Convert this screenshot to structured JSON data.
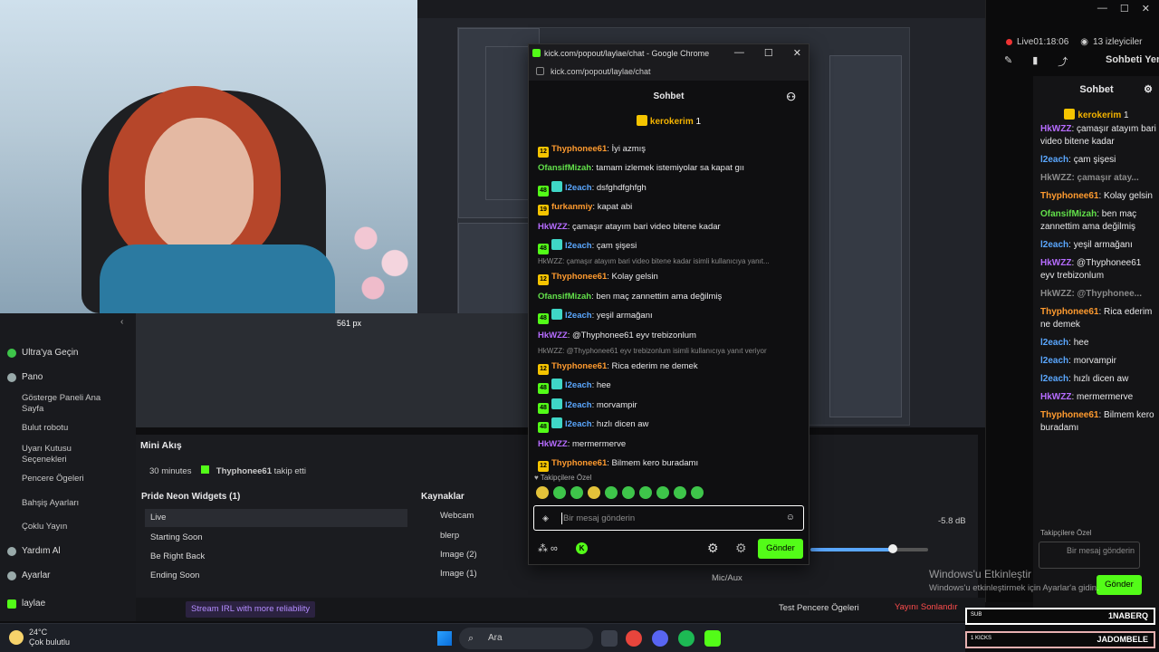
{
  "popup": {
    "window_title": "kick.com/popout/laylae/chat - Google Chrome",
    "url": "kick.com/popout/laylae/chat",
    "chat_title": "Sohbet",
    "pinned_user": "kerokerim",
    "pinned_count": "1",
    "messages": [
      {
        "type": "msg",
        "badges": [
          "12"
        ],
        "user": "Thyphonee61",
        "color": "orange",
        "text": "İyi azmış"
      },
      {
        "type": "msg",
        "badges": [],
        "user": "OfansifMizah",
        "color": "green",
        "text": "tamam izlemek istemiyolar sa kapat gıı"
      },
      {
        "type": "msg",
        "badges": [
          "48",
          "sub"
        ],
        "user": "l2each",
        "color": "blue",
        "text": "dsfghdfghfgh"
      },
      {
        "type": "msg",
        "badges": [
          "19"
        ],
        "user": "furkanmiy",
        "color": "orange",
        "text": "kapat abi"
      },
      {
        "type": "msg",
        "badges": [],
        "user": "HkWZZ",
        "color": "purple",
        "text": "çamaşır atayım bari video bitene kadar"
      },
      {
        "type": "msg",
        "badges": [
          "48",
          "sub"
        ],
        "user": "l2each",
        "color": "blue",
        "text": "çam şişesi"
      },
      {
        "type": "reply",
        "text": "HkWZZ: çamaşır atayım bari video bitene kadar isimli kullanıcıya yanıt..."
      },
      {
        "type": "msg",
        "badges": [
          "12"
        ],
        "user": "Thyphonee61",
        "color": "orange",
        "text": "Kolay gelsin"
      },
      {
        "type": "msg",
        "badges": [],
        "user": "OfansifMizah",
        "color": "green",
        "text": "ben maç zannettim ama değilmiş"
      },
      {
        "type": "msg",
        "badges": [
          "48",
          "sub"
        ],
        "user": "l2each",
        "color": "blue",
        "text": "yeşil armağanı"
      },
      {
        "type": "msg",
        "badges": [],
        "user": "HkWZZ",
        "color": "purple",
        "text": "@Thyphonee61 eyv trebizonlum"
      },
      {
        "type": "reply",
        "text": "HkWZZ: @Thyphonee61 eyv trebizonlum isimli kullanıcıya yanıt veriyor"
      },
      {
        "type": "msg",
        "badges": [
          "12"
        ],
        "user": "Thyphonee61",
        "color": "orange",
        "text": "Rica ederim ne demek"
      },
      {
        "type": "msg",
        "badges": [
          "48",
          "sub"
        ],
        "user": "l2each",
        "color": "blue",
        "text": "hee"
      },
      {
        "type": "msg",
        "badges": [
          "48",
          "sub"
        ],
        "user": "l2each",
        "color": "blue",
        "text": "morvampir"
      },
      {
        "type": "msg",
        "badges": [
          "48",
          "sub"
        ],
        "user": "l2each",
        "color": "blue",
        "text": "hızlı dicen aw"
      },
      {
        "type": "msg",
        "badges": [],
        "user": "HkWZZ",
        "color": "purple",
        "text": "mermermerve"
      },
      {
        "type": "msg",
        "badges": [
          "12"
        ],
        "user": "Thyphonee61",
        "color": "orange",
        "text": "Bilmem kero buradamı"
      }
    ],
    "follower_note": "Takipçilere Özel",
    "input_placeholder": "Bir mesaj gönderin",
    "send_label": "Gönder"
  },
  "right_panel": {
    "live_time": "Live01:18:06",
    "viewers": "13 izleyiciler",
    "refresh_chat": "Sohbeti Yenile",
    "chat_title": "Sohbet",
    "pinned_user": "kerokerim",
    "pinned_count": "1",
    "messages": [
      {
        "user": "HkWZZ",
        "color": "purple",
        "text": "çamaşır atayım bari video bitene kadar"
      },
      {
        "user": "l2each",
        "color": "blue",
        "text": "çam şişesi"
      },
      {
        "user": "HkWZZ: çamaşır atay...",
        "color": "gray",
        "text": ""
      },
      {
        "user": "Thyphonee61",
        "color": "orange",
        "text": "Kolay gelsin"
      },
      {
        "user": "OfansifMizah",
        "color": "green",
        "text": "ben maç zannettim ama değilmiş"
      },
      {
        "user": "l2each",
        "color": "blue",
        "text": "yeşil armağanı"
      },
      {
        "user": "HkWZZ",
        "color": "purple",
        "text": "@Thyphonee61 eyv trebizonlum"
      },
      {
        "user": "HkWZZ: @Thyphonee...",
        "color": "gray",
        "text": ""
      },
      {
        "user": "Thyphonee61",
        "color": "orange",
        "text": "Rica ederim ne demek"
      },
      {
        "user": "l2each",
        "color": "blue",
        "text": "hee"
      },
      {
        "user": "l2each",
        "color": "blue",
        "text": "morvampir"
      },
      {
        "user": "l2each",
        "color": "blue",
        "text": "hızlı dicen aw"
      },
      {
        "user": "HkWZZ",
        "color": "purple",
        "text": "mermermerve"
      },
      {
        "user": "Thyphonee61",
        "color": "orange",
        "text": "Bilmem kero buradamı"
      }
    ],
    "follower_note": "Takipçilere Özel",
    "input_placeholder": "Bir mesaj gönderin",
    "send_label": "Gönder"
  },
  "sidebar": {
    "items": [
      {
        "label": "Ultra'ya Geçin"
      },
      {
        "label": "Pano"
      }
    ],
    "sub_items": [
      "Gösterge Paneli Ana Sayfa",
      "Bulut robotu",
      "Uyarı Kutusu Seçenekleri",
      "Pencere Ögeleri",
      "Bahşiş Ayarları",
      "Çoklu Yayın"
    ],
    "bottom_items": [
      {
        "label": "Yardım Al"
      },
      {
        "label": "Ayarlar"
      },
      {
        "label": "laylae"
      }
    ]
  },
  "mini_akis": {
    "title": "Mini Akış",
    "time": "30 minutes",
    "follower": "Thyphonee61",
    "action": "takip etti"
  },
  "scenes": {
    "header": "Pride Neon Widgets (1)",
    "items": [
      "Live",
      "Starting Soon",
      "Be Right Back",
      "Ending Soon"
    ]
  },
  "sources": {
    "header": "Kaynaklar",
    "items": [
      "Webcam",
      "blerp",
      "Image (2)",
      "Image (1)"
    ]
  },
  "audio": {
    "mic_label": "Mic/Aux",
    "db": "-5.8 dB"
  },
  "obs_bottom": {
    "irl": "Stream IRL with more reliability",
    "test": "Test Pencere Ögeleri",
    "end": "Yayını Sonlandır"
  },
  "preview_label": "561 px",
  "windows": {
    "activate_title": "Windows'u Etkinleştir",
    "activate_sub": "Windows'u etkinleştirmek için Ayarlar'a gidin."
  },
  "overlays": {
    "sub_label": "SUB",
    "sub_name": "1NABERQ",
    "kick_label": "1 KICKS",
    "kick_name": "JADOMBELE"
  },
  "taskbar": {
    "temp": "24°C",
    "weather": "Çok bulutlu",
    "search": "Ara"
  },
  "colors": {
    "kick_green": "#53fc18",
    "orange": "#ff9b2f",
    "purple": "#b66cff",
    "blue": "#5aa7ff",
    "green": "#62e04a"
  }
}
